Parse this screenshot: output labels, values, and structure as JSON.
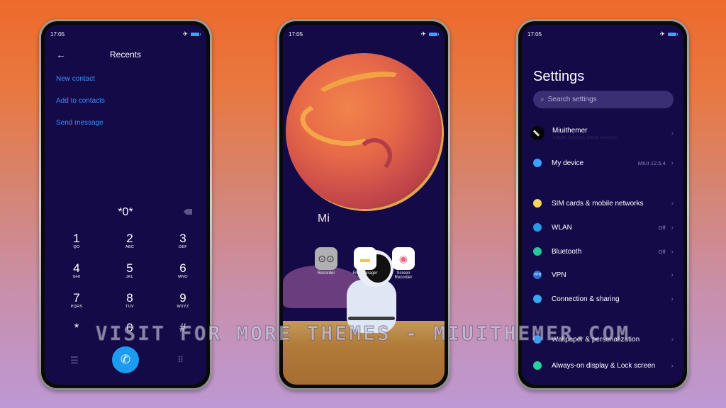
{
  "background": {
    "top_color": "#ed6a2c",
    "bottom_color": "#bd98d4"
  },
  "status_bar": {
    "time": "17:05",
    "airplane_icon": "airplane-icon",
    "battery_icon": "battery-icon"
  },
  "dialer": {
    "title": "Recents",
    "back_icon": "back-arrow-icon",
    "links": [
      "New contact",
      "Add to contacts",
      "Send message"
    ],
    "entered_number": "*0*",
    "keys": [
      {
        "digit": "1",
        "letters": "QO"
      },
      {
        "digit": "2",
        "letters": "ABC"
      },
      {
        "digit": "3",
        "letters": "DEF"
      },
      {
        "digit": "4",
        "letters": "GHI"
      },
      {
        "digit": "5",
        "letters": "JKL"
      },
      {
        "digit": "6",
        "letters": "MNO"
      },
      {
        "digit": "7",
        "letters": "PQRS"
      },
      {
        "digit": "8",
        "letters": "TUV"
      },
      {
        "digit": "9",
        "letters": "WXYZ"
      },
      {
        "digit": "*",
        "letters": ""
      },
      {
        "digit": "0",
        "letters": ""
      },
      {
        "digit": "#",
        "letters": ""
      }
    ],
    "call_color": "#1c9bf0",
    "link_color": "#3b8cff"
  },
  "home": {
    "label": "Mi",
    "apps": [
      {
        "name": "Recorder",
        "icon": "recorder-icon"
      },
      {
        "name": "File Manager",
        "icon": "folder-icon"
      },
      {
        "name": "Screen Recorder",
        "icon": "screen-recorder-icon"
      }
    ]
  },
  "settings": {
    "title": "Settings",
    "search_placeholder": "Search settings",
    "account": {
      "name": "Miuithemer",
      "subtitle": "Xiaomi Account, Cloud services"
    },
    "items": [
      {
        "label": "My device",
        "value": "MIUI 12.5.4",
        "icon": "device-icon",
        "color": "#3aa3ff"
      },
      {
        "label": "SIM cards & mobile networks",
        "value": "",
        "icon": "sim-icon",
        "color": "#f5d65a"
      },
      {
        "label": "WLAN",
        "value": "Off",
        "icon": "wlan-icon",
        "color": "#2b9ae6"
      },
      {
        "label": "Bluetooth",
        "value": "Off",
        "icon": "bluetooth-icon",
        "color": "#27c99a"
      },
      {
        "label": "VPN",
        "value": "",
        "icon": "vpn-icon",
        "color": "#2b6fd6"
      },
      {
        "label": "Connection & sharing",
        "value": "",
        "icon": "connection-icon",
        "color": "#35a8f0"
      },
      {
        "label": "Wallpaper & personalization",
        "value": "",
        "icon": "wallpaper-icon",
        "color": "#3aa3ff"
      },
      {
        "label": "Always-on display & Lock screen",
        "value": "",
        "icon": "lock-screen-icon",
        "color": "#26d3a0"
      }
    ]
  },
  "watermark": "VISIT FOR MORE THEMES - MIUITHEMER.COM"
}
